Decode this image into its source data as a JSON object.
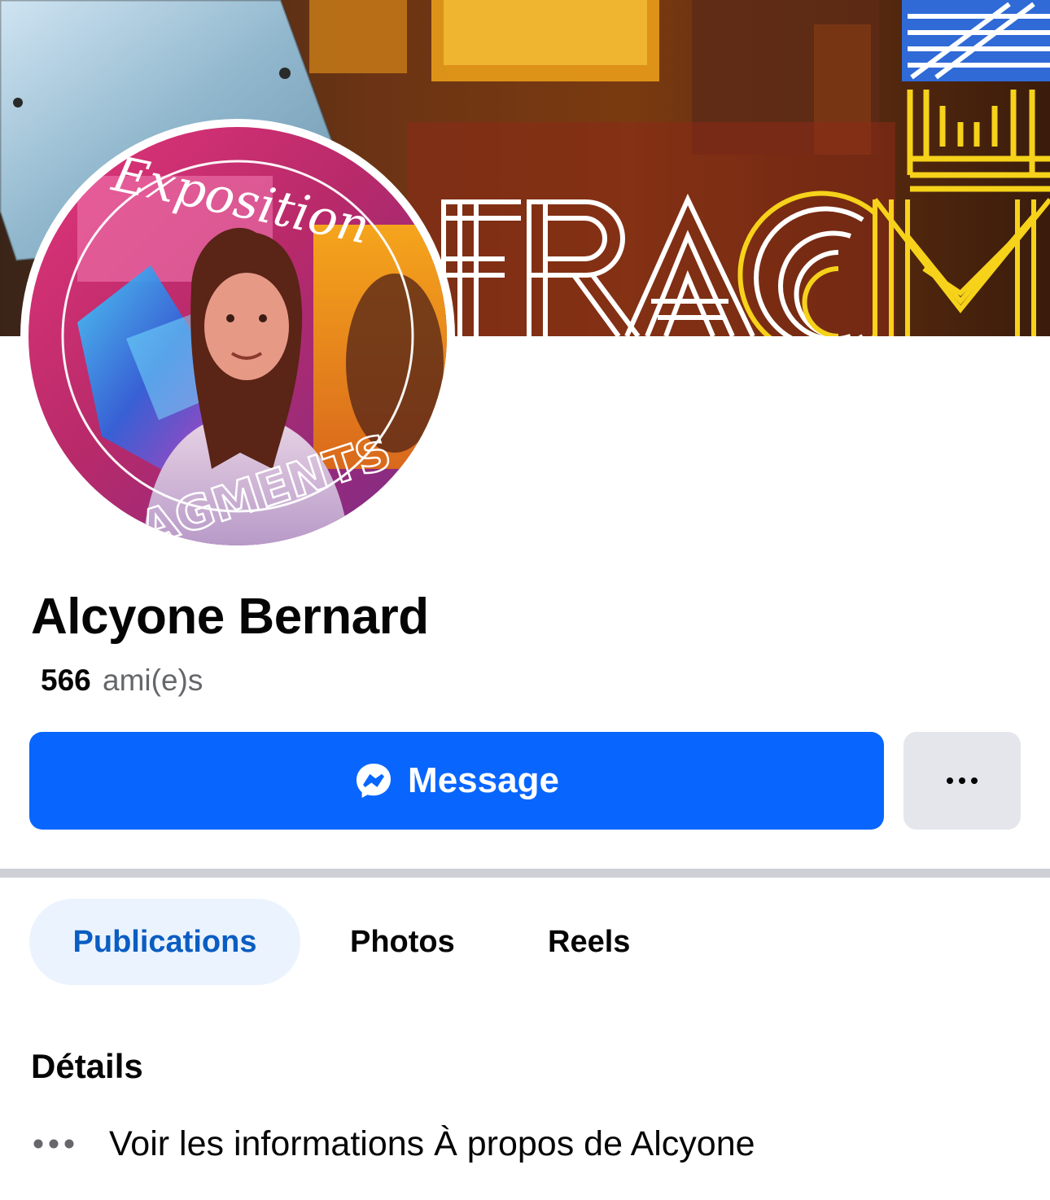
{
  "cover": {
    "lettering": "FRAGM",
    "colors": {
      "white_lines": "#ffffff",
      "yellow_lines": "#f6d21a",
      "blue_panel": "#2f6ad6"
    }
  },
  "avatar": {
    "lettering_top": "Exposition",
    "lettering_bottom": "FRAGMENTS"
  },
  "profile": {
    "name": "Alcyone Bernard",
    "friends_count": "566",
    "friends_label": "ami(e)s"
  },
  "actions": {
    "message_label": "Message",
    "message_icon": "messenger-icon",
    "more_icon": "more-options-icon",
    "primary_color": "#0866ff"
  },
  "tabs": [
    {
      "label": "Publications",
      "active": true
    },
    {
      "label": "Photos",
      "active": false
    },
    {
      "label": "Reels",
      "active": false
    }
  ],
  "details": {
    "title": "Détails",
    "row_icon": "more-dots-icon",
    "row_text": "Voir les informations À propos de Alcyone"
  }
}
